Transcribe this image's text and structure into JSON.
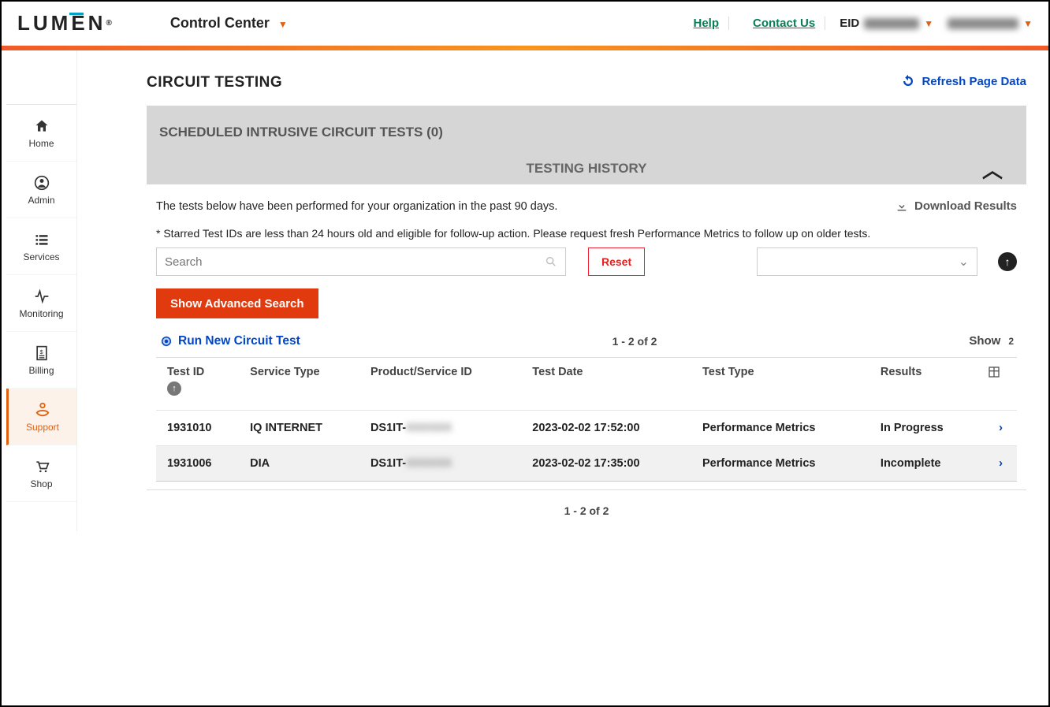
{
  "header": {
    "logo_text": "LUMEN",
    "app_name": "Control Center",
    "help": "Help",
    "contact": "Contact Us",
    "eid_label": "EID"
  },
  "sidebar": {
    "items": [
      {
        "label": "Home",
        "icon": "⌂"
      },
      {
        "label": "Admin",
        "icon": "◉"
      },
      {
        "label": "Services",
        "icon": "≣"
      },
      {
        "label": "Monitoring",
        "icon": "∿"
      },
      {
        "label": "Billing",
        "icon": "▤"
      },
      {
        "label": "Support",
        "icon": "✋"
      },
      {
        "label": "Shop",
        "icon": "🛒"
      }
    ]
  },
  "page": {
    "title": "CIRCUIT TESTING",
    "refresh": "Refresh Page Data",
    "scheduled_title": "SCHEDULED INTRUSIVE CIRCUIT TESTS (0)",
    "history_title": "TESTING HISTORY",
    "help_text": "The tests below have been performed for your organization in the past 90 days.",
    "download": "Download Results",
    "note": "* Starred Test IDs are less than 24 hours old and eligible for follow-up action. Please request fresh Performance Metrics to follow up on older tests.",
    "search_placeholder": "Search",
    "reset": "Reset",
    "adv_search": "Show Advanced Search",
    "run_new": "Run New Circuit Test",
    "pager": "1 - 2 of 2",
    "show_label": "Show",
    "show_count": "2",
    "columns": [
      "Test ID",
      "Service Type",
      "Product/Service ID",
      "Test Date",
      "Test Type",
      "Results"
    ],
    "rows": [
      {
        "test_id": "1931010",
        "service_type": "IQ INTERNET",
        "psid_prefix": "DS1IT-",
        "psid_rest": "XXXXXX",
        "test_date": "2023-02-02 17:52:00",
        "test_type": "Performance Metrics",
        "results": "In Progress"
      },
      {
        "test_id": "1931006",
        "service_type": "DIA",
        "psid_prefix": "DS1IT-",
        "psid_rest": "XXXXXX",
        "test_date": "2023-02-02 17:35:00",
        "test_type": "Performance Metrics",
        "results": "Incomplete"
      }
    ],
    "bottom_pager": "1 - 2 of 2"
  }
}
